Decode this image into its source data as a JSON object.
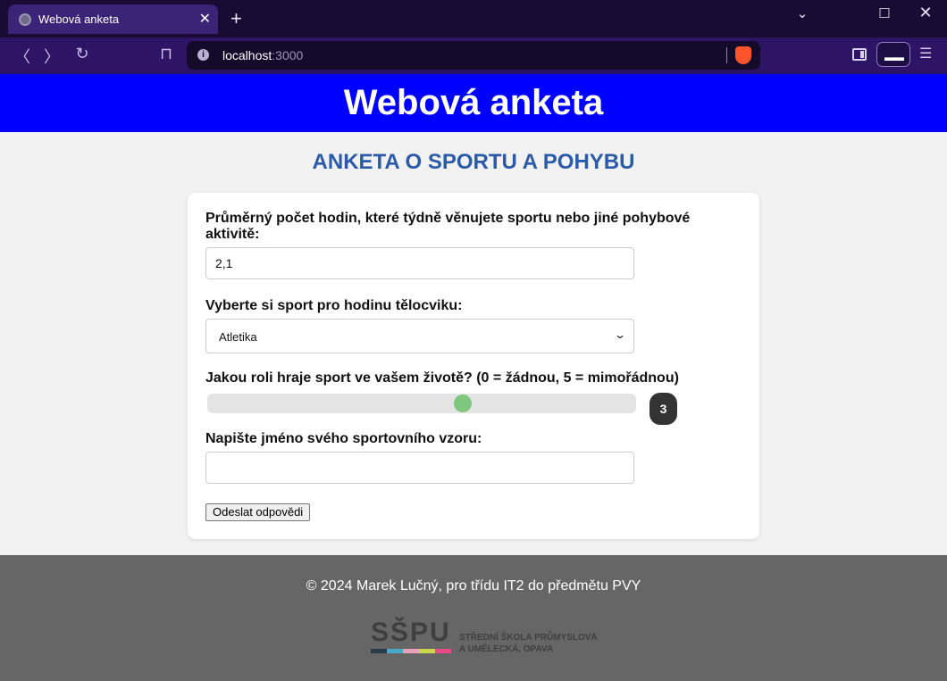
{
  "browser": {
    "tab_title": "Webová anketa",
    "url_host": "localhost",
    "url_port": ":3000"
  },
  "page": {
    "header_title": "Webová anketa",
    "survey_title": "ANKETA O SPORTU A POHYBU"
  },
  "form": {
    "q1_label": "Průměrný počet hodin, které týdně věnujete sportu nebo jiné pohybové aktivitě:",
    "q1_value": "2,1",
    "q2_label": "Vyberte si sport pro hodinu tělocviku:",
    "q2_selected": "Atletika",
    "q3_label": "Jakou roli hraje sport ve vašem životě? (0 = žádnou, 5 = mimořádnou)",
    "q3_min": 0,
    "q3_max": 5,
    "q3_value": "3",
    "q4_label": "Napište jméno svého sportovního vzoru:",
    "q4_value": "",
    "submit_label": "Odeslat odpovědi"
  },
  "footer": {
    "copyright": "© 2024 Marek Lučný, pro třídu IT2 do předmětu PVY",
    "logo_mark": "SŠPU",
    "logo_line1": "STŘEDNÍ ŠKOLA PRŮMYSLOVÁ",
    "logo_line2": "A UMĚLECKÁ, OPAVA"
  },
  "colors": {
    "header_bg": "#0000ff",
    "survey_title": "#2b5aa8",
    "slider_thumb": "#7fc77f",
    "footer_bg": "#666666",
    "logo_bars": [
      "#2b3a4a",
      "#4aa8c8",
      "#e8a0b4",
      "#c8d84a",
      "#e84a8a"
    ]
  },
  "icons": {
    "back": "chevron-left-icon",
    "forward": "chevron-right-icon",
    "reload": "reload-icon",
    "bookmark": "bookmark-icon",
    "info": "info-icon",
    "shield": "brave-shield-icon",
    "sidebar": "sidebar-icon",
    "private": "glasses-icon",
    "menu": "hamburger-menu-icon"
  }
}
